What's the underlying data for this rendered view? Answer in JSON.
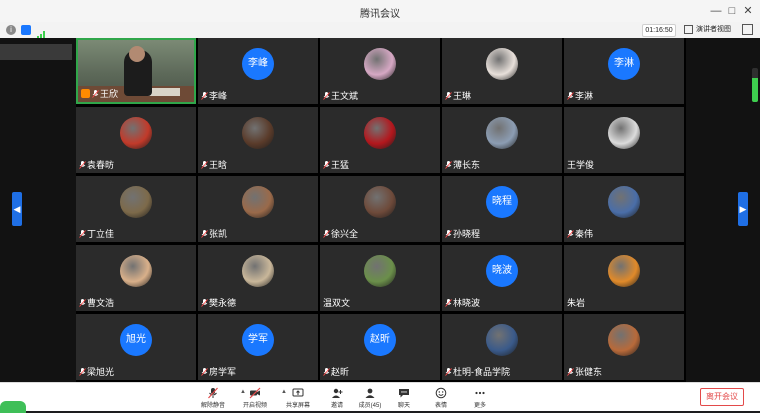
{
  "window": {
    "title": "腾讯会议"
  },
  "infobar": {
    "timer": "01:16:50",
    "view_toggle_label": "演讲者视图"
  },
  "participants": [
    {
      "name": "王欣",
      "kind": "video",
      "host": true
    },
    {
      "name": "李峰",
      "kind": "text",
      "avatar_text": "李峰"
    },
    {
      "name": "王文斌",
      "kind": "image",
      "avatar_color": "#d6a8c4"
    },
    {
      "name": "王琳",
      "kind": "image",
      "avatar_color": "#e8e0da"
    },
    {
      "name": "李淋",
      "kind": "text",
      "avatar_text": "李淋"
    },
    {
      "name": "袁春昉",
      "kind": "image",
      "avatar_color": "#c23a2a"
    },
    {
      "name": "王晗",
      "kind": "image",
      "avatar_color": "#5a3b2a"
    },
    {
      "name": "王猛",
      "kind": "image",
      "avatar_color": "#b3171d"
    },
    {
      "name": "薄长东",
      "kind": "image",
      "avatar_color": "#8c9db3"
    },
    {
      "name": "王学俊",
      "kind": "image",
      "avatar_color": "#dcdcdc",
      "no_mic": true
    },
    {
      "name": "丁立佳",
      "kind": "image",
      "avatar_color": "#7d6a4a"
    },
    {
      "name": "张凯",
      "kind": "image",
      "avatar_color": "#9a6a4a"
    },
    {
      "name": "徐兴全",
      "kind": "image",
      "avatar_color": "#6e4a3a"
    },
    {
      "name": "孙晓程",
      "kind": "text",
      "avatar_text": "晓程"
    },
    {
      "name": "秦伟",
      "kind": "image",
      "avatar_color": "#4a6ea8"
    },
    {
      "name": "曹文浩",
      "kind": "image",
      "avatar_color": "#d9b08a"
    },
    {
      "name": "樊永德",
      "kind": "image",
      "avatar_color": "#c9b79a"
    },
    {
      "name": "温双文",
      "kind": "image",
      "avatar_color": "#6b8f4a",
      "no_mic": true
    },
    {
      "name": "林晓波",
      "kind": "text",
      "avatar_text": "晓波"
    },
    {
      "name": "朱岩",
      "kind": "image",
      "avatar_color": "#e08a2a",
      "no_mic": true
    },
    {
      "name": "梁旭光",
      "kind": "text",
      "avatar_text": "旭光"
    },
    {
      "name": "房学军",
      "kind": "text",
      "avatar_text": "学军"
    },
    {
      "name": "赵昕",
      "kind": "text",
      "avatar_text": "赵昕"
    },
    {
      "name": "杜明-食品学院",
      "kind": "image",
      "avatar_color": "#3a5a8a"
    },
    {
      "name": "张健东",
      "kind": "image",
      "avatar_color": "#b86a3a"
    }
  ],
  "toolbar": {
    "items": [
      {
        "label": "解除静音",
        "icon": "mic-muted-icon"
      },
      {
        "label": "开启视频",
        "icon": "camera-off-icon"
      },
      {
        "label": "共享屏幕",
        "icon": "screen-share-icon"
      },
      {
        "label": "邀请",
        "icon": "invite-icon"
      },
      {
        "label": "成员(45)",
        "icon": "members-icon"
      },
      {
        "label": "聊天",
        "icon": "chat-icon"
      },
      {
        "label": "表情",
        "icon": "emoji-icon"
      },
      {
        "label": "更多",
        "icon": "more-icon"
      }
    ],
    "leave_label": "离开会议"
  },
  "colors": {
    "accent": "#1a78ff",
    "active_speaker": "#30a64a",
    "leave": "#e34a4a"
  },
  "volume_level": 0.7
}
